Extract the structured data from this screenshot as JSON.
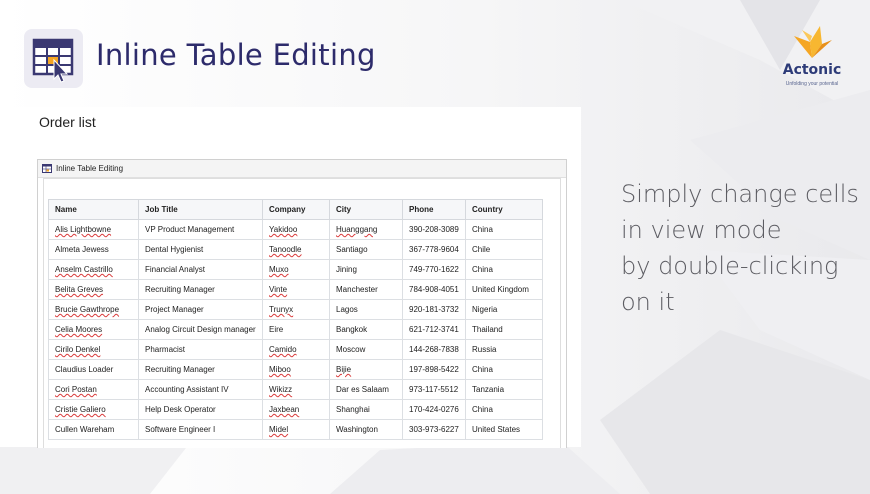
{
  "header": {
    "title": "Inline Table Editing",
    "icon": "table-edit-icon"
  },
  "logo": {
    "name": "Actonic",
    "tagline": "Unfolding your potential",
    "color_primary": "#f5a623",
    "color_text": "#2d3b78"
  },
  "panel": {
    "title": "Order list",
    "window_title": "Inline Table Editing"
  },
  "table": {
    "columns": [
      "Name",
      "Job Title",
      "Company",
      "City",
      "Phone",
      "Country"
    ],
    "rows": [
      [
        "Alis Lightbowne",
        "VP Product Management",
        "Yakidoo",
        "Huanggang",
        "390-208-3089",
        "China"
      ],
      [
        "Almeta Jewess",
        "Dental Hygienist",
        "Tanoodle",
        "Santiago",
        "367-778-9604",
        "Chile"
      ],
      [
        "Anselm Castrillo",
        "Financial Analyst",
        "Muxo",
        "Jining",
        "749-770-1622",
        "China"
      ],
      [
        "Belita Greves",
        "Recruiting Manager",
        "Vinte",
        "Manchester",
        "784-908-4051",
        "United Kingdom"
      ],
      [
        "Brucie Gawthrope",
        "Project Manager",
        "Trunyx",
        "Lagos",
        "920-181-3732",
        "Nigeria"
      ],
      [
        "Celia Moores",
        "Analog Circuit Design manager",
        "Eire",
        "Bangkok",
        "621-712-3741",
        "Thailand"
      ],
      [
        "Cirilo Denkel",
        "Pharmacist",
        "Camido",
        "Moscow",
        "144-268-7838",
        "Russia"
      ],
      [
        "Claudius Loader",
        "Recruiting Manager",
        "Miboo",
        "Bijie",
        "197-898-5422",
        "China"
      ],
      [
        "Cori Postan",
        "Accounting Assistant IV",
        "Wikizz",
        "Dar es Salaam",
        "973-117-5512",
        "Tanzania"
      ],
      [
        "Cristie Galiero",
        "Help Desk Operator",
        "Jaxbean",
        "Shanghai",
        "170-424-0276",
        "China"
      ],
      [
        "Cullen Wareham",
        "Software Engineer I",
        "Midel",
        "Washington",
        "303-973-6227",
        "United States"
      ]
    ]
  },
  "side_text": {
    "lines": [
      "Simply change cells",
      "in view mode",
      "by double-clicking",
      "on it"
    ]
  },
  "colors": {
    "title": "#2d2b6b",
    "accent_orange": "#f5a623",
    "side_text": "#5c5c62"
  }
}
